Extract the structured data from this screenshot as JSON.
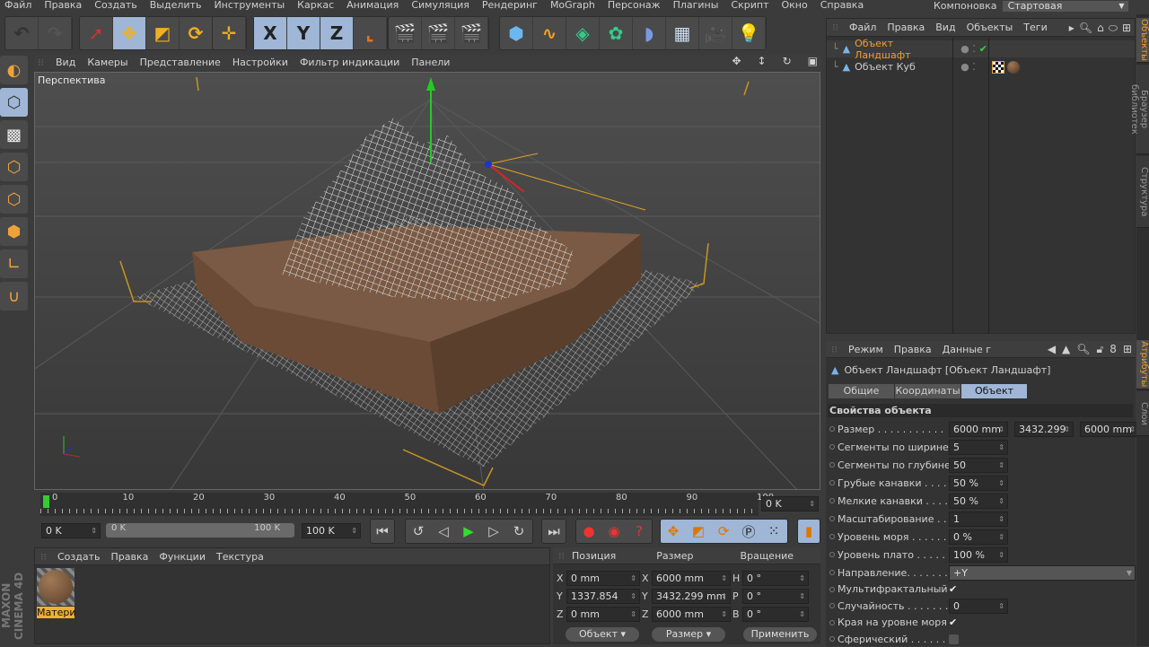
{
  "menu": [
    "Файл",
    "Правка",
    "Создать",
    "Выделить",
    "Инструменты",
    "Каркас",
    "Анимация",
    "Симуляция",
    "Рендеринг",
    "MoGraph",
    "Персонаж",
    "Плагины",
    "Скрипт",
    "Окно",
    "Справка"
  ],
  "layout": {
    "label": "Компоновка",
    "value": "Стартовая"
  },
  "toolbar": [
    {
      "icon": "undo-icon",
      "glyph": "↶"
    },
    {
      "icon": "redo-icon",
      "glyph": "↷"
    },
    {
      "icon": "live-select-icon",
      "glyph": "➚"
    },
    {
      "icon": "move-icon",
      "glyph": "✥"
    },
    {
      "icon": "scale-icon",
      "glyph": "◩"
    },
    {
      "icon": "rotate-icon",
      "glyph": "⟳"
    },
    {
      "icon": "last-tool-icon",
      "glyph": "✛"
    },
    {
      "icon": "x-axis-icon",
      "glyph": "X"
    },
    {
      "icon": "y-axis-icon",
      "glyph": "Y"
    },
    {
      "icon": "z-axis-icon",
      "glyph": "Z"
    },
    {
      "icon": "coordinate-system-icon",
      "glyph": "⌞"
    },
    {
      "icon": "render-view-icon",
      "glyph": "🎬"
    },
    {
      "icon": "render-picture-viewer-icon",
      "glyph": "🎬"
    },
    {
      "icon": "render-settings-icon",
      "glyph": "🎬"
    },
    {
      "icon": "cube-icon",
      "glyph": "⬢"
    },
    {
      "icon": "spline-icon",
      "glyph": "∿"
    },
    {
      "icon": "subdivision-icon",
      "glyph": "◈"
    },
    {
      "icon": "mograph-cloner-icon",
      "glyph": "✿"
    },
    {
      "icon": "deformer-icon",
      "glyph": "◗"
    },
    {
      "icon": "floor-icon",
      "glyph": "▦"
    },
    {
      "icon": "camera-icon",
      "glyph": "🎥"
    },
    {
      "icon": "light-icon",
      "glyph": "💡"
    }
  ],
  "viewport": {
    "menu": [
      "Вид",
      "Камеры",
      "Представление",
      "Настройки",
      "Фильтр индикации",
      "Панели"
    ],
    "label": "Перспектива"
  },
  "timeline": {
    "ticks": [
      "0",
      "10",
      "20",
      "30",
      "40",
      "50",
      "60",
      "70",
      "80",
      "90",
      "100"
    ],
    "current": "0 K",
    "start": "0 K",
    "range_start": "0 K",
    "range_end": "100 K",
    "end": "100 K",
    "progress": 0
  },
  "materials": {
    "menu": [
      "Создать",
      "Правка",
      "Функции",
      "Текстура"
    ],
    "items": [
      {
        "name": "Матери"
      }
    ],
    "brand": "MAXON CINEMA 4D"
  },
  "coords": {
    "headers": [
      "Позиция",
      "Размер",
      "Вращение"
    ],
    "rows": [
      {
        "a": "X",
        "pos": "0 mm",
        "b": "X",
        "size": "6000 mm",
        "c": "H",
        "rot": "0 °"
      },
      {
        "a": "Y",
        "pos": "1337.854 mm",
        "b": "Y",
        "size": "3432.299 mm",
        "c": "P",
        "rot": "0 °"
      },
      {
        "a": "Z",
        "pos": "0 mm",
        "b": "Z",
        "size": "6000 mm",
        "c": "B",
        "rot": "0 °"
      }
    ],
    "mode": "Объект",
    "size_mode": "Размер",
    "apply": "Применить"
  },
  "objects": {
    "menu": [
      "Файл",
      "Правка",
      "Вид",
      "Объекты",
      "Теги"
    ],
    "items": [
      {
        "name": "Объект Ландшафт",
        "selected": true
      },
      {
        "name": "Объект Куб",
        "selected": false
      }
    ]
  },
  "attributes": {
    "menu": [
      "Режим",
      "Правка",
      "Данные г"
    ],
    "title": "Объект Ландшафт [Объект Ландшафт]",
    "tabs": [
      "Общие",
      "Координаты",
      "Объект"
    ],
    "active_tab": 2,
    "section": "Свойства объекта",
    "size": [
      "6000 mm",
      "3432.299",
      "6000 mm"
    ],
    "props": [
      {
        "label": "Размер . . . . . . . . . . .",
        "type": "size"
      },
      {
        "label": "Сегменты по ширине",
        "value": "5"
      },
      {
        "label": "Сегменты по глубине",
        "value": "50"
      },
      {
        "label": "Грубые канавки . . . .",
        "value": "50 %"
      },
      {
        "label": "Мелкие канавки . . . .",
        "value": "50 %"
      },
      {
        "label": "Масштабирование . .",
        "value": "1"
      },
      {
        "label": "Уровень моря . . . . . .",
        "value": "0 %"
      },
      {
        "label": "Уровень плато . . . . .",
        "value": "100 %"
      },
      {
        "label": "Направление. . . . . . .",
        "value": "+Y",
        "type": "dropdown"
      },
      {
        "label": "Мультифрактальный",
        "checked": true,
        "type": "check"
      },
      {
        "label": "Случайность . . . . . . .",
        "value": "0"
      },
      {
        "label": "Края на уровне моря",
        "checked": true,
        "type": "check"
      },
      {
        "label": "Сферический . . . . . .",
        "checked": false,
        "type": "check"
      }
    ]
  },
  "side_tabs": [
    "Объекты",
    "Браузер библиотек",
    "Структура",
    "Атрибуты",
    "Слои"
  ],
  "colors": {
    "accent": "#f0a030",
    "selected_tab": "#9fb6d6",
    "bg": "#3b3b3b"
  }
}
